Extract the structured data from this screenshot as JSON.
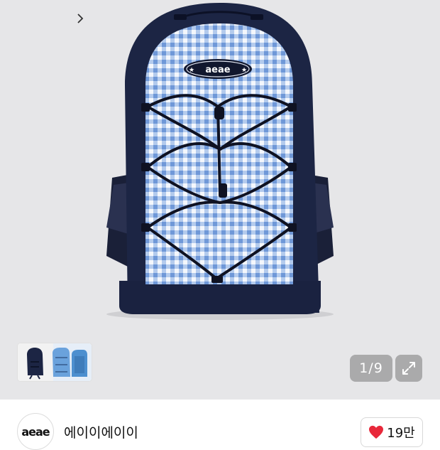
{
  "product": {
    "brand_patch_text": "aeae",
    "image_counter": "1/9"
  },
  "thumbnails": [
    {
      "name": "thumb-navy-backpack"
    },
    {
      "name": "thumb-blue-backpack"
    }
  ],
  "seller": {
    "avatar_text": "aeae",
    "name": "에이이에이이",
    "likes": "19만"
  },
  "icons": {
    "next": "chevron-right-icon",
    "expand": "expand-icon",
    "like": "heart-icon"
  },
  "colors": {
    "navy": "#1c2544",
    "gingham_light": "#c9daf2",
    "gingham_dark": "#7ea5df",
    "heart": "#e8283a",
    "background": "#e6e6e8"
  }
}
